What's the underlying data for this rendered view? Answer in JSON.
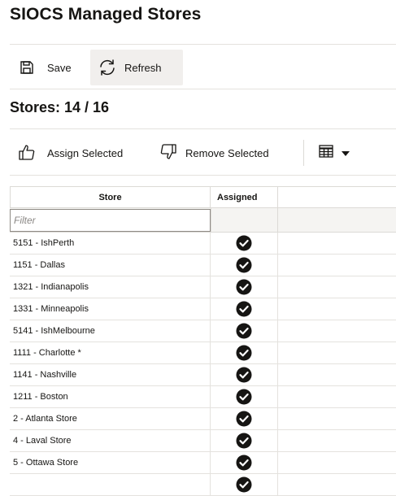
{
  "page": {
    "title": "SIOCS Managed Stores"
  },
  "toolbar": {
    "save_label": "Save",
    "refresh_label": "Refresh"
  },
  "subtitle": "Stores: 14 / 16",
  "actions": {
    "assign_label": "Assign Selected",
    "remove_label": "Remove Selected",
    "columns_icon": "table-icon"
  },
  "grid": {
    "columns": [
      "Store",
      "Assigned"
    ],
    "filter_placeholder": "Filter",
    "rows": [
      {
        "store": "5151 - IshPerth",
        "assigned": true
      },
      {
        "store": "1151 - Dallas",
        "assigned": true
      },
      {
        "store": "1321 - Indianapolis",
        "assigned": true
      },
      {
        "store": "1331 - Minneapolis",
        "assigned": true
      },
      {
        "store": "5141 - IshMelbourne",
        "assigned": true
      },
      {
        "store": "1111 - Charlotte *",
        "assigned": true
      },
      {
        "store": "1141 - Nashville",
        "assigned": true
      },
      {
        "store": "1211 - Boston",
        "assigned": true
      },
      {
        "store": "2 - Atlanta Store",
        "assigned": true
      },
      {
        "store": "4 - Laval Store",
        "assigned": true
      },
      {
        "store": "5 - Ottawa Store",
        "assigned": true
      },
      {
        "store": "",
        "assigned": true
      }
    ]
  }
}
